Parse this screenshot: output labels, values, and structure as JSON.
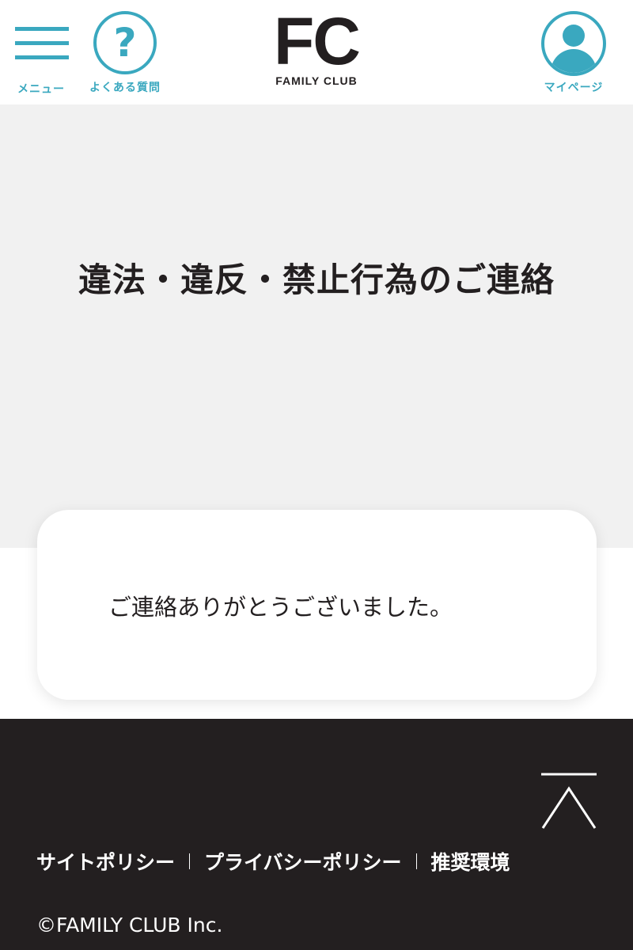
{
  "header": {
    "menu_label": "メニュー",
    "faq_label": "よくある質問",
    "faq_glyph": "?",
    "logo_main": "FC",
    "logo_sub": "FAMILY CLUB",
    "mypage_label": "マイページ"
  },
  "main": {
    "title": "違法・違反・禁止行為のご連絡",
    "message": "ご連絡ありがとうございました。"
  },
  "footer": {
    "links": [
      "サイトポリシー",
      "プライバシーポリシー",
      "推奨環境"
    ],
    "copyright": "©FAMILY CLUB Inc."
  },
  "colors": {
    "accent": "#3aa8bf",
    "banner_bg": "#f1f1f1",
    "footer_bg": "#231f20",
    "text": "#231f20"
  },
  "icons": {
    "menu": "hamburger-icon",
    "faq": "question-icon",
    "mypage": "user-icon",
    "pagetop": "chevron-up-icon"
  }
}
